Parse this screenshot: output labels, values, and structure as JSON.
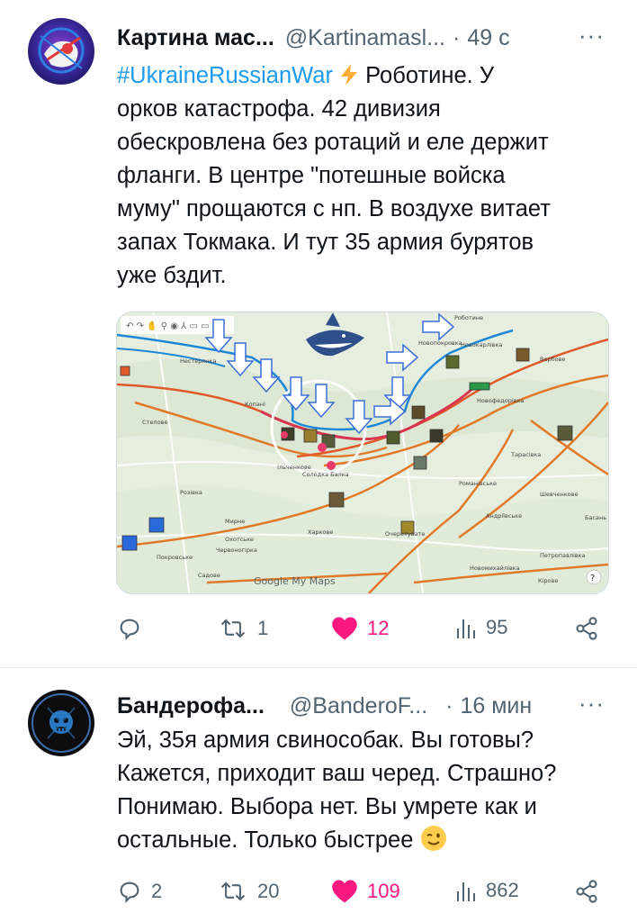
{
  "tweets": [
    {
      "author_name": "Картина мас...",
      "handle": "@Kartinamasl...",
      "separator": "·",
      "time": "49 с",
      "more_label": "···",
      "hashtag": "#UkraineRussianWar",
      "lines": [
        "Роботине. У",
        "орков катастрофа. 42 дивизия",
        "обескровлена без ротаций и еле держит",
        "фланги. В центре \"потешные войска",
        "муму\" прощаются с нп. В воздухе витает",
        "запах Токмака. И тут 35 армия бурятов",
        "уже бздит."
      ],
      "map": {
        "watermark": "Google My Maps",
        "help": "?",
        "labels": [
          "Роботине",
          "Новопокровка",
          "Новокарлівка",
          "Вербове",
          "Новофедорівка",
          "Копані",
          "Степове",
          "Мирне",
          "Нестерянка",
          "Солодка Балка",
          "Ільченкове",
          "Охотське",
          "Харкове",
          "Очеретувате",
          "Романівське",
          "Андріївське",
          "Шевченкове",
          "Тарасівка",
          "Петропавлівка",
          "Новомихайлівка",
          "Кірове",
          "Покровське",
          "Червоногірка",
          "Садове",
          "Розівка",
          "Басань"
        ]
      },
      "stats": {
        "replies": "",
        "retweets": "1",
        "likes": "12",
        "views": "95"
      }
    },
    {
      "author_name": "Бандерофа...",
      "handle": "@BanderoF...",
      "separator": "·",
      "time": "16 мин",
      "more_label": "···",
      "lines": [
        "Эй, 35я армия свинособак. Вы готовы?",
        "Кажется, приходит ваш черед. Страшно?",
        "Понимаю. Выбора нет. Вы умрете как и",
        "остальные. Только  быстрее"
      ],
      "avatar_text": "УКРАЇНСЬКА ЛЮТЬ · СМЕРТЬ ВОРОГАМ",
      "stats": {
        "replies": "2",
        "retweets": "20",
        "likes": "109",
        "views": "862"
      }
    }
  ],
  "colors": {
    "link": "#1d9bf0",
    "like": "#f91880",
    "muted": "#536471",
    "text": "#0f1419"
  },
  "icons": [
    "reply-icon",
    "retweet-icon",
    "like-icon",
    "views-icon",
    "share-icon",
    "lightning-icon",
    "wink-emoji-icon"
  ]
}
